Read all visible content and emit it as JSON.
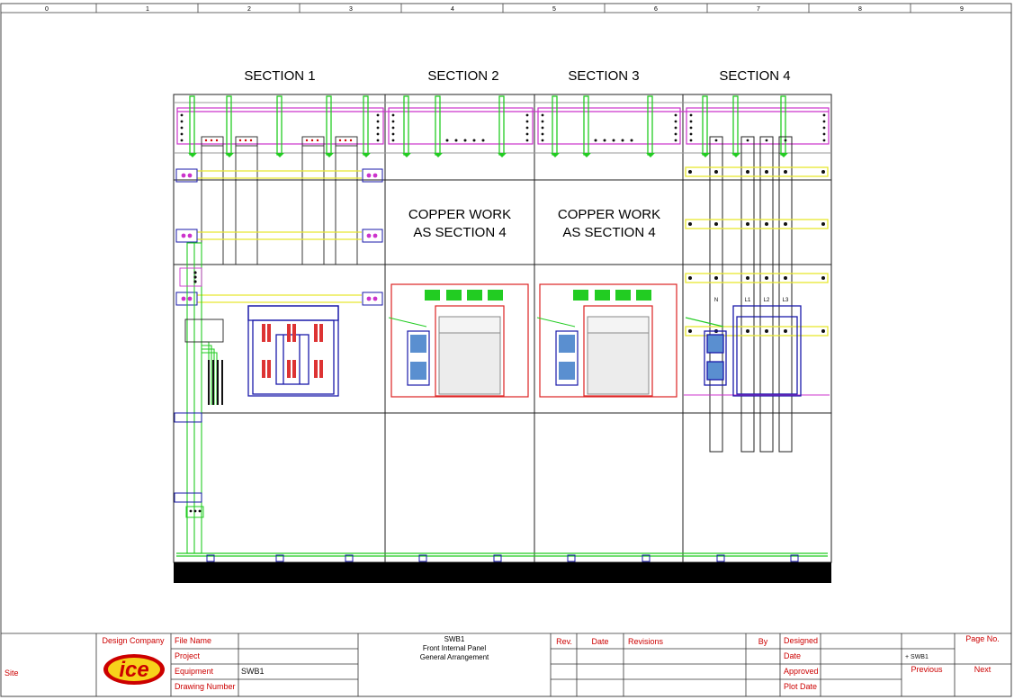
{
  "ruler": {
    "labels": [
      "0",
      "1",
      "2",
      "3",
      "4",
      "5",
      "6",
      "7",
      "8",
      "9"
    ]
  },
  "drawing": {
    "sections": [
      "SECTION 1",
      "SECTION 2",
      "SECTION 3",
      "SECTION 4"
    ],
    "note_s2_line1": "COPPER WORK",
    "note_s2_line2": "AS SECTION 4",
    "note_s3_line1": "COPPER WORK",
    "note_s3_line2": "AS SECTION 4",
    "phase_labels": [
      "N",
      "L1",
      "L2",
      "L3"
    ]
  },
  "title_block": {
    "site_label": "Site",
    "design_company_label": "Design Company",
    "logo_text": "ice",
    "file_name_label": "File Name",
    "project_label": "Project",
    "equipment_label": "Equipment",
    "equipment_value": "SWB1",
    "drawing_number_label": "Drawing Number",
    "title_line1": "SWB1",
    "title_line2": "Front Internal Panel",
    "title_line3": "General Arrangement",
    "rev_label": "Rev.",
    "date_label": "Date",
    "revisions_label": "Revisions",
    "by_label": "By",
    "designed_label": "Designed",
    "date2_label": "Date",
    "approved_label": "Approved",
    "plot_date_label": "Plot Date",
    "sheet_ref": "+ SWB1",
    "page_no_label": "Page No.",
    "previous_label": "Previous",
    "next_label": "Next"
  },
  "colors": {
    "title_red": "#cc0000",
    "busbar_green": "#22cc22",
    "busbar_magenta": "#cc33cc",
    "busbar_yellow": "#e8e830",
    "breaker_blue": "#1a1aaa",
    "frame_red": "#dd2222"
  }
}
